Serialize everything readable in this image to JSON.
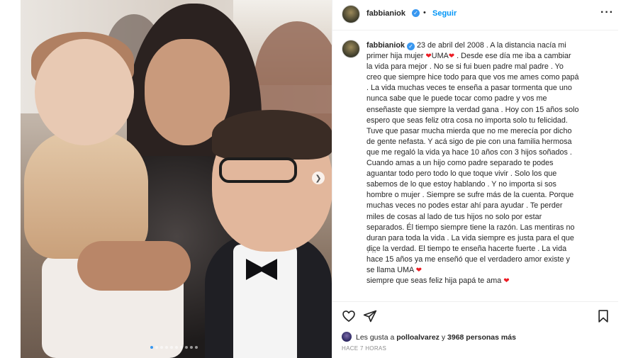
{
  "post": {
    "author": {
      "username": "fabbianiok",
      "verified": true,
      "follow_label": "Seguir",
      "separator": "•"
    },
    "more_icon": "more-horizontal-icon",
    "caption": {
      "username": "fabbianiok",
      "parts": [
        " 23 de abril del 2008 . A la distancia nacía mi primer hija mujer ",
        "UMA",
        " . Desde ese día me iba a cambiar la vida para mejor . No se si fui buen padre mal padre . Yo creo que siempre hice todo para que vos me ames como papá . La vida muchas veces te enseña a pasar tormenta que uno nunca sabe que le puede tocar como padre y vos me enseñaste que siempre la verdad gana . Hoy con 15 años solo espero que seas feliz otra cosa no importa solo tu felicidad. Tuve que pasar mucha mierda que no me merecía por dicho de gente nefasta. Y acá sigo de pie con una familia hermosa que me regaló la vida ya hace 10 años con 3 hijos soñados . Cuando amas a un hijo como padre separado te podes aguantar todo pero todo lo que toque vivir . Solo los que sabemos de lo que estoy hablando . Y no importa si sos hombre o mujer . Siempre se sufre más de la cuenta. Porque muchas veces no podes estar ahí para ayudar . Te perder miles de cosas al lado de tus hijos no solo por estar separados. Él tiempo siempre tiene la razón. Las mentiras no duran para toda la vida . La vida siempre es justa para el que dice la verdad. El tiempo te enseña hacerte fuerte . La vida hace 15 años ya me enseñó que el verdadero amor existe y se llama UMA ",
        " siempre que seas feliz hija papá te ama "
      ],
      "heart": "❤",
      "relative_time": "7 h"
    },
    "actions": {
      "like_icon": "heart-outline-icon",
      "share_icon": "paper-plane-icon",
      "save_icon": "bookmark-icon"
    },
    "likes": {
      "prefix": "Les gusta a ",
      "user": "polloalvarez",
      "middle": " y ",
      "count": "3968 personas más"
    },
    "posted_ago": "HACE 7 HORAS",
    "carousel": {
      "next_icon": "chevron-right-icon",
      "dot_count": 10,
      "active_index": 0
    }
  }
}
